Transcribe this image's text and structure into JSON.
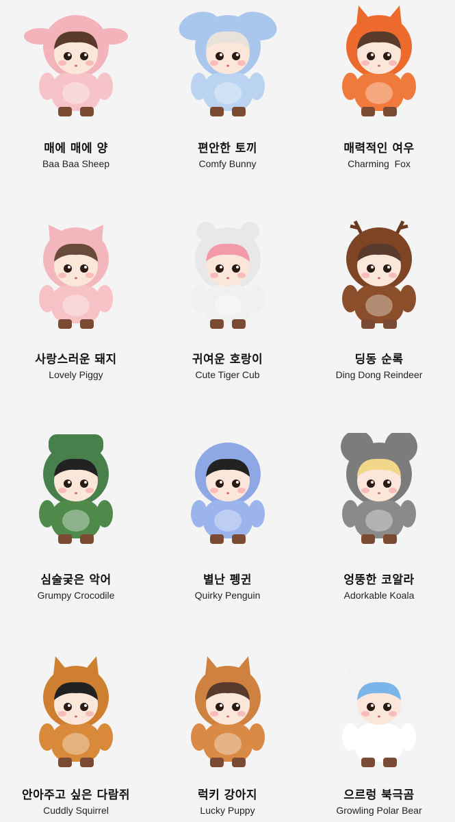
{
  "figures": [
    {
      "ko": "매에 매에 양",
      "en": "Baa Baa Sheep",
      "icon": "sheep-costume-doll",
      "suit": "#f6c4c8",
      "hood": "#f3b3bb",
      "hair": "#5a3a2a"
    },
    {
      "ko": "편안한 토끼",
      "en": "Comfy Bunny",
      "icon": "bunny-costume-doll",
      "suit": "#b9d3f0",
      "hood": "#a9c6ec",
      "hair": "#e8e2da"
    },
    {
      "ko": "매력적인 여우",
      "en": "Charming  Fox",
      "icon": "fox-costume-doll",
      "suit": "#f07a3c",
      "hood": "#ec6a2c",
      "hair": "#5a3a2a"
    },
    {
      "ko": "사랑스러운 돼지",
      "en": "Lovely Piggy",
      "icon": "pig-costume-doll",
      "suit": "#f6c2c6",
      "hood": "#f3b6bc",
      "hair": "#6a4a3a"
    },
    {
      "ko": "귀여운 호랑이",
      "en": "Cute Tiger Cub",
      "icon": "tiger-costume-doll",
      "suit": "#f0f0f0",
      "hood": "#e8e8e8",
      "hair": "#f39aa8"
    },
    {
      "ko": "딩동 순록",
      "en": "Ding Dong Reindeer",
      "icon": "reindeer-costume-doll",
      "suit": "#8a4f2a",
      "hood": "#7d4524",
      "hair": "#5a3a2a"
    },
    {
      "ko": "심술궂은 악어",
      "en": "Grumpy Crocodile",
      "icon": "crocodile-costume-doll",
      "suit": "#4f8a4a",
      "hood": "#47804a",
      "hair": "#222222"
    },
    {
      "ko": "별난 펭귄",
      "en": "Quirky Penguin",
      "icon": "penguin-costume-doll",
      "suit": "#9cb4ec",
      "hood": "#8ea8e6",
      "hair": "#222222"
    },
    {
      "ko": "엉뚱한 코알라",
      "en": "Adorkable Koala",
      "icon": "koala-costume-doll",
      "suit": "#8a8a8a",
      "hood": "#7c7c7c",
      "hair": "#f2d68a"
    },
    {
      "ko": "안아주고 싶은 다람쥐",
      "en": "Cuddly Squirrel",
      "icon": "squirrel-costume-doll",
      "suit": "#d8893a",
      "hood": "#cf7f30",
      "hair": "#222222"
    },
    {
      "ko": "럭키 강아지",
      "en": "Lucky Puppy",
      "icon": "puppy-costume-doll",
      "suit": "#d98b45",
      "hood": "#cf8240",
      "hair": "#5a3a2a"
    },
    {
      "ko": "으르렁 북극곰",
      "en": "Growling Polar Bear",
      "icon": "polar-bear-costume-doll",
      "suit": "#ffffff",
      "hood": "#f2f2f2",
      "hair": "#7ab4e8"
    }
  ]
}
